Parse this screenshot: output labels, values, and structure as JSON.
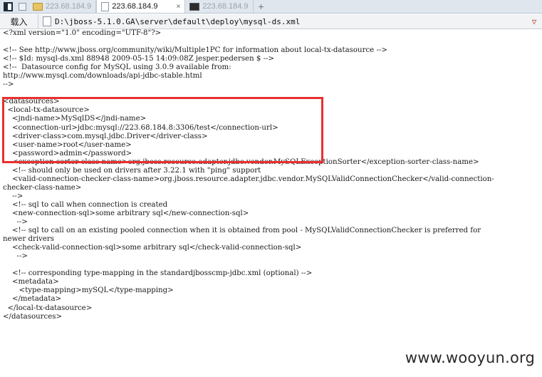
{
  "tabbar": {
    "tabs": [
      {
        "label": "223.68.184.9",
        "icon": "folder-icon",
        "active": false
      },
      {
        "label": "223.68.184.9",
        "icon": "page-icon",
        "active": true
      },
      {
        "label": "223.68.184.9",
        "icon": "terminal-icon",
        "active": false
      }
    ],
    "close_glyph": "×",
    "new_tab_glyph": "+"
  },
  "addressbar": {
    "load_label": "载入",
    "path": "D:\\jboss-5.1.0.GA\\server\\default\\deploy\\mysql-ds.xml",
    "dropdown_glyph": "▽"
  },
  "file_lines": [
    "<?xml version=\"1.0\" encoding=\"UTF-8\"?>",
    "",
    "<!-- See http://www.jboss.org/community/wiki/Multiple1PC for information about local-tx-datasource -->",
    "<!-- $Id: mysql-ds.xml 88948 2009-05-15 14:09:08Z jesper.pedersen $ -->",
    "<!--  Datasource config for MySQL using 3.0.9 available from:",
    "http://www.mysql.com/downloads/api-jdbc-stable.html",
    "-->",
    "",
    "<datasources>",
    "  <local-tx-datasource>",
    "    <jndi-name>MySqlDS</jndi-name>",
    "    <connection-url>jdbc:mysql://223.68.184.8:3306/test</connection-url>",
    "    <driver-class>com.mysql.jdbc.Driver</driver-class>",
    "    <user-name>root</user-name>",
    "    <password>admin</password>",
    "    <exception-sorter-class-name>org.jboss.resource.adapter.jdbc.vendor.MySQLExceptionSorter</exception-sorter-class-name>",
    "    <!-- should only be used on drivers after 3.22.1 with \"ping\" support",
    "    <valid-connection-checker-class-name>org.jboss.resource.adapter.jdbc.vendor.MySQLValidConnectionChecker</valid-connection-",
    "checker-class-name>",
    "    -->",
    "    <!-- sql to call when connection is created",
    "    <new-connection-sql>some arbitrary sql</new-connection-sql>",
    "      -->",
    "    <!-- sql to call on an existing pooled connection when it is obtained from pool - MySQLValidConnectionChecker is preferred for",
    "newer drivers",
    "    <check-valid-connection-sql>some arbitrary sql</check-valid-connection-sql>",
    "      -->",
    "",
    "    <!-- corresponding type-mapping in the standardjbosscmp-jdbc.xml (optional) -->",
    "    <metadata>",
    "       <type-mapping>mySQL</type-mapping>",
    "    </metadata>",
    "  </local-tx-datasource>",
    "</datasources>"
  ],
  "watermark": "www.wooyun.org",
  "colors": {
    "highlight": "#e8302f",
    "tabbar_bg": "#dfe6ee"
  }
}
